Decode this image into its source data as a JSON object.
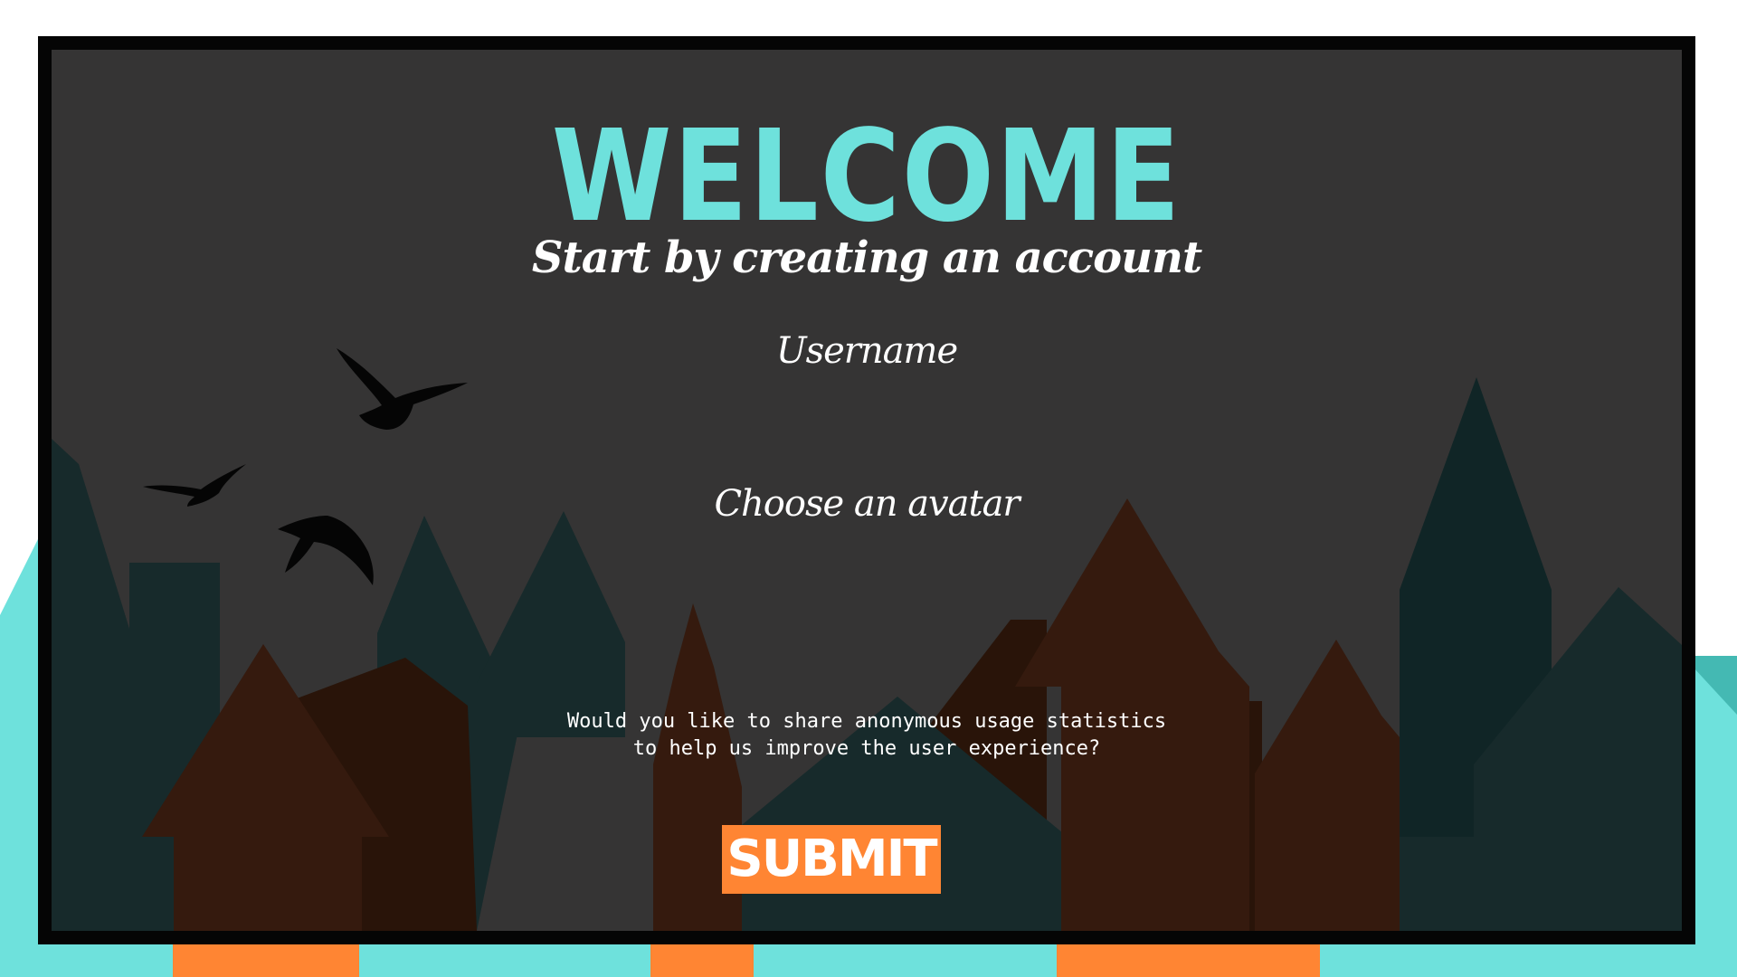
{
  "welcome": {
    "title": "WELCOME",
    "subtitle": "Start by creating an account"
  },
  "form": {
    "username_label": "Username",
    "username_value": "",
    "avatar_label": "Choose an avatar",
    "stats_line1": "Would you like to share anonymous usage statistics",
    "stats_line2": "to help us improve the user experience?",
    "submit_label": "SUBMIT"
  },
  "colors": {
    "accent": "#6ee1dc",
    "button": "#ff8533",
    "panel": "#353434",
    "frame": "#050505",
    "tree_dark": "#172a2b",
    "house_brown": "#351a0e"
  },
  "icons": {
    "birds": "bird-silhouette-icon"
  }
}
